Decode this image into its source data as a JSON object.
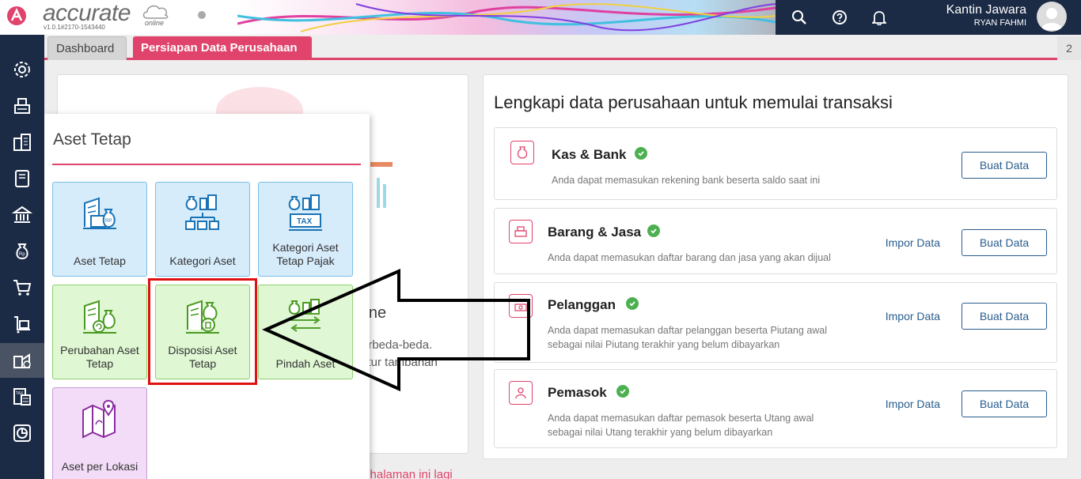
{
  "header": {
    "logo_text": "accurate",
    "logo_sub": "online",
    "version": "v1.0.1#2170-1543440",
    "user_name": "Kantin Jawara",
    "user_sub": "RYAN FAHMI",
    "icons": [
      "search-icon",
      "help-icon",
      "bell-icon"
    ]
  },
  "tabs": {
    "dashboard": "Dashboard",
    "persiapan": "Persiapan Data Perusahaan",
    "more": "2"
  },
  "sidebar": {
    "items": [
      "gear-icon",
      "register-icon",
      "building-icon",
      "book-icon",
      "bank-icon",
      "money-bag-icon",
      "cart-icon",
      "inventory-icon",
      "fixed-asset-icon",
      "tax-icon",
      "report-icon"
    ],
    "active_index": 8
  },
  "left_card": {
    "heading": "line",
    "line1": "erbeda-beda.",
    "line2": "fitur tambahan",
    "bottom_link": "n halaman ini lagi"
  },
  "right_card": {
    "title": "Lengkapi data perusahaan untuk memulai transaksi",
    "rows": [
      {
        "title": "Kas & Bank",
        "desc1": "Anda dapat memasukan rekening bank beserta saldo saat ini",
        "desc2": "",
        "impor": "",
        "buat": "Buat Data"
      },
      {
        "title": "Barang & Jasa",
        "desc1": "Anda dapat memasukan daftar barang dan jasa yang akan dijual",
        "desc2": "",
        "impor": "Impor Data",
        "buat": "Buat Data"
      },
      {
        "title": "Pelanggan",
        "desc1": "Anda dapat memasukan daftar pelanggan beserta Piutang awal",
        "desc2": "sebagai nilai Piutang terakhir yang belum dibayarkan",
        "impor": "Impor Data",
        "buat": "Buat Data"
      },
      {
        "title": "Pemasok",
        "desc1": "Anda dapat memasukan daftar pemasok beserta Utang awal",
        "desc2": "sebagai nilai Utang terakhir yang belum dibayarkan",
        "impor": "Impor Data",
        "buat": "Buat Data"
      }
    ]
  },
  "popup": {
    "title": "Aset Tetap",
    "tiles": [
      {
        "label": "Aset Tetap",
        "color": "blue"
      },
      {
        "label": "Kategori Aset",
        "color": "blue"
      },
      {
        "label": "Kategori Aset Tetap Pajak",
        "color": "blue"
      },
      {
        "label": "Perubahan Aset Tetap",
        "color": "green"
      },
      {
        "label": "Disposisi Aset Tetap",
        "color": "green"
      },
      {
        "label": "Pindah Aset",
        "color": "green"
      },
      {
        "label": "Aset per Lokasi",
        "color": "purple"
      }
    ],
    "tax_text": "TAX",
    "rp_text": "RP"
  },
  "colors": {
    "accent": "#e0436c",
    "navy": "#1b2a45",
    "link": "#2a5d8e",
    "highlight": "#e01010"
  }
}
